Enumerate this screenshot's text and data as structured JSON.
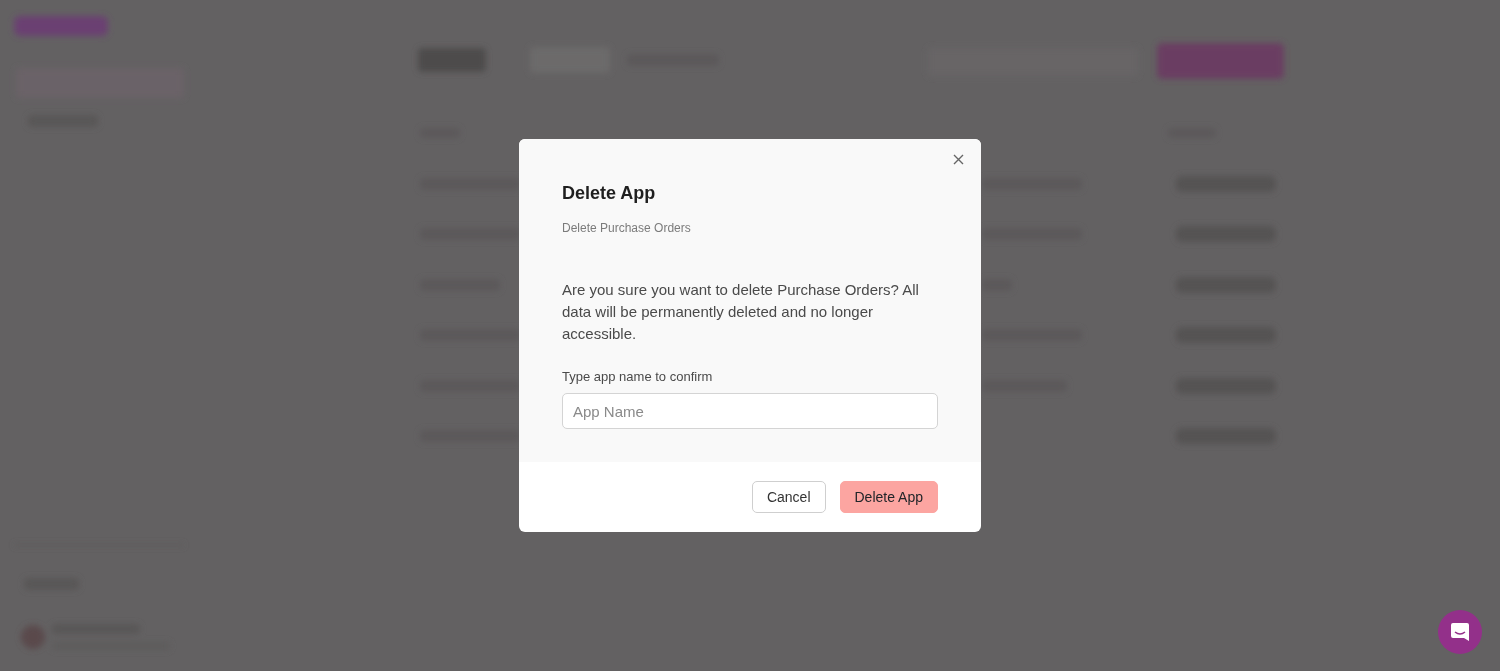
{
  "dialog": {
    "title": "Delete App",
    "subtitle": "Delete Purchase Orders",
    "message": "Are you sure you want to delete Purchase Orders? All data will be permanently deleted and no longer accessible.",
    "field": {
      "label": "Type app name to confirm",
      "placeholder": "App Name"
    },
    "buttons": [
      {
        "label": "Cancel",
        "kind": "secondary",
        "disabled": false
      },
      {
        "label": "Delete App",
        "kind": "danger",
        "disabled": true
      }
    ]
  }
}
